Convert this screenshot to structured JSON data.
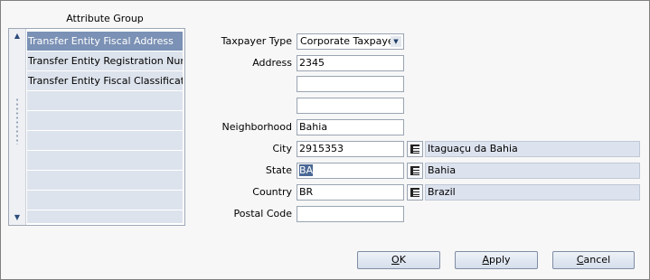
{
  "attribute_group": {
    "title": "Attribute Group",
    "items": [
      {
        "label": "Transfer Entity Fiscal Address",
        "selected": true
      },
      {
        "label": "Transfer Entity Registration Number",
        "selected": false
      },
      {
        "label": "Transfer Entity Fiscal Classification",
        "selected": false
      },
      {
        "label": "",
        "selected": false
      },
      {
        "label": "",
        "selected": false
      },
      {
        "label": "",
        "selected": false
      },
      {
        "label": "",
        "selected": false
      },
      {
        "label": "",
        "selected": false
      },
      {
        "label": "",
        "selected": false
      },
      {
        "label": "",
        "selected": false
      }
    ]
  },
  "form": {
    "taxpayer_type": {
      "label": "Taxpayer Type",
      "value": "Corporate Taxpayer"
    },
    "address": {
      "label": "Address",
      "line1": "2345",
      "line2": "",
      "line3": ""
    },
    "neighborhood": {
      "label": "Neighborhood",
      "value": "Bahia"
    },
    "city": {
      "label": "City",
      "code": "2915353",
      "name": "Itaguaçu da Bahia"
    },
    "state": {
      "label": "State",
      "code": "BA",
      "name": "Bahia"
    },
    "country": {
      "label": "Country",
      "code": "BR",
      "name": "Brazil"
    },
    "postal_code": {
      "label": "Postal Code",
      "value": ""
    }
  },
  "buttons": {
    "ok": {
      "mnemonic": "O",
      "rest": "K"
    },
    "apply": {
      "mnemonic": "A",
      "rest": "pply"
    },
    "cancel": {
      "mnemonic": "C",
      "rest": "ancel"
    }
  },
  "colors": {
    "selected_row": "#7b91b5",
    "list_row": "#dde3ec",
    "readonly_field": "#dde3ee",
    "text_highlight": "#4a6795"
  },
  "icons": {
    "scroll_up": "scroll-up-arrow-icon",
    "scroll_down": "scroll-down-arrow-icon",
    "lov": "list-of-values-icon",
    "dropdown": "dropdown-arrow-icon"
  }
}
